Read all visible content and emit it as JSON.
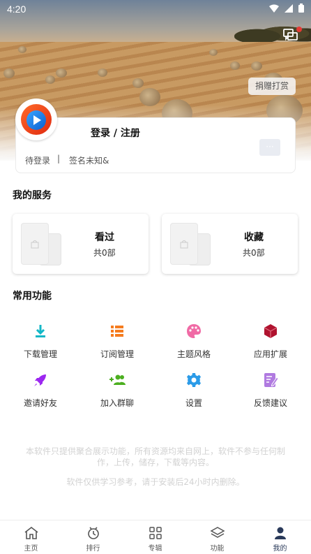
{
  "status_bar": {
    "time": "4:20",
    "icons": [
      "wifi-icon",
      "signal-icon",
      "battery-icon"
    ]
  },
  "header": {
    "message_icon": "message-icon",
    "donate_label": "捐赠打赏"
  },
  "profile": {
    "login_label": "登录 / 注册",
    "status": "待登录",
    "separator": "|",
    "signature": "签名未知&",
    "more_label": "···"
  },
  "services": {
    "title": "我的服务",
    "items": [
      {
        "label": "看过",
        "count": "共0部"
      },
      {
        "label": "收藏",
        "count": "共0部"
      }
    ]
  },
  "functions": {
    "title": "常用功能",
    "items": [
      {
        "label": "下载管理",
        "icon": "download-icon",
        "color": "#13b7c7"
      },
      {
        "label": "订阅管理",
        "icon": "list-icon",
        "color": "#f57c1f"
      },
      {
        "label": "主题风格",
        "icon": "palette-icon",
        "color": "#f06aa5"
      },
      {
        "label": "应用扩展",
        "icon": "cube-icon",
        "color": "#b0132f"
      },
      {
        "label": "邀请好友",
        "icon": "rocket-icon",
        "color": "#9c27f0"
      },
      {
        "label": "加入群聊",
        "icon": "group-add-icon",
        "color": "#4caf20"
      },
      {
        "label": "设置",
        "icon": "gear-icon",
        "color": "#2b9be8"
      },
      {
        "label": "反馈建议",
        "icon": "feedback-icon",
        "color": "#b07ae0"
      }
    ]
  },
  "disclaimer": {
    "line1": "本软件只提供聚合展示功能，所有资源均来自网上，软件不参与任何制作，上传，储存，下载等内容。",
    "line2": "软件仅供学习参考，请于安装后24小时内删除。"
  },
  "bottom_nav": {
    "items": [
      {
        "label": "主页",
        "icon": "home-icon"
      },
      {
        "label": "排行",
        "icon": "rank-icon"
      },
      {
        "label": "专辑",
        "icon": "grid-icon"
      },
      {
        "label": "功能",
        "icon": "layers-icon"
      },
      {
        "label": "我的",
        "icon": "person-icon"
      }
    ],
    "active_index": 4,
    "active_color": "#2a3a5a"
  }
}
